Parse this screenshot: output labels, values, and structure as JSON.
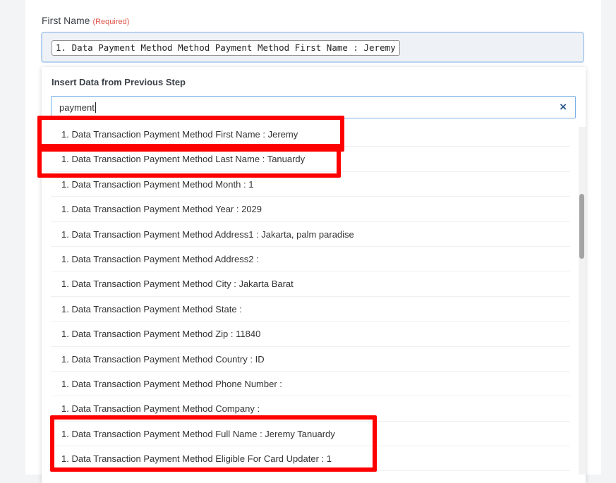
{
  "field": {
    "label": "First Name",
    "required": "(Required)",
    "value_chip": "1. Data Payment Method Method Payment Method First Name : Jeremy"
  },
  "dropdown": {
    "title": "Insert Data from Previous Step",
    "search_value": "payment",
    "clear_icon": "×",
    "items": [
      "1. Data Transaction Payment Method First Name : Jeremy",
      "1. Data Transaction Payment Method Last Name : Tanuardy",
      "1. Data Transaction Payment Method Month : 1",
      "1. Data Transaction Payment Method Year : 2029",
      "1. Data Transaction Payment Method Address1 : Jakarta, palm paradise",
      "1. Data Transaction Payment Method Address2 :",
      "1. Data Transaction Payment Method City : Jakarta Barat",
      "1. Data Transaction Payment Method State :",
      "1. Data Transaction Payment Method Zip : 11840",
      "1. Data Transaction Payment Method Country : ID",
      "1. Data Transaction Payment Method Phone Number :",
      "1. Data Transaction Payment Method Company :",
      "1. Data Transaction Payment Method Full Name : Jeremy Tanuardy",
      "1. Data Transaction Payment Method Eligible For Card Updater : 1"
    ]
  },
  "colors": {
    "highlight": "#ff0000",
    "search_border": "#7bb1e8",
    "field_border": "#b8d2ee",
    "required": "#e0554b"
  }
}
